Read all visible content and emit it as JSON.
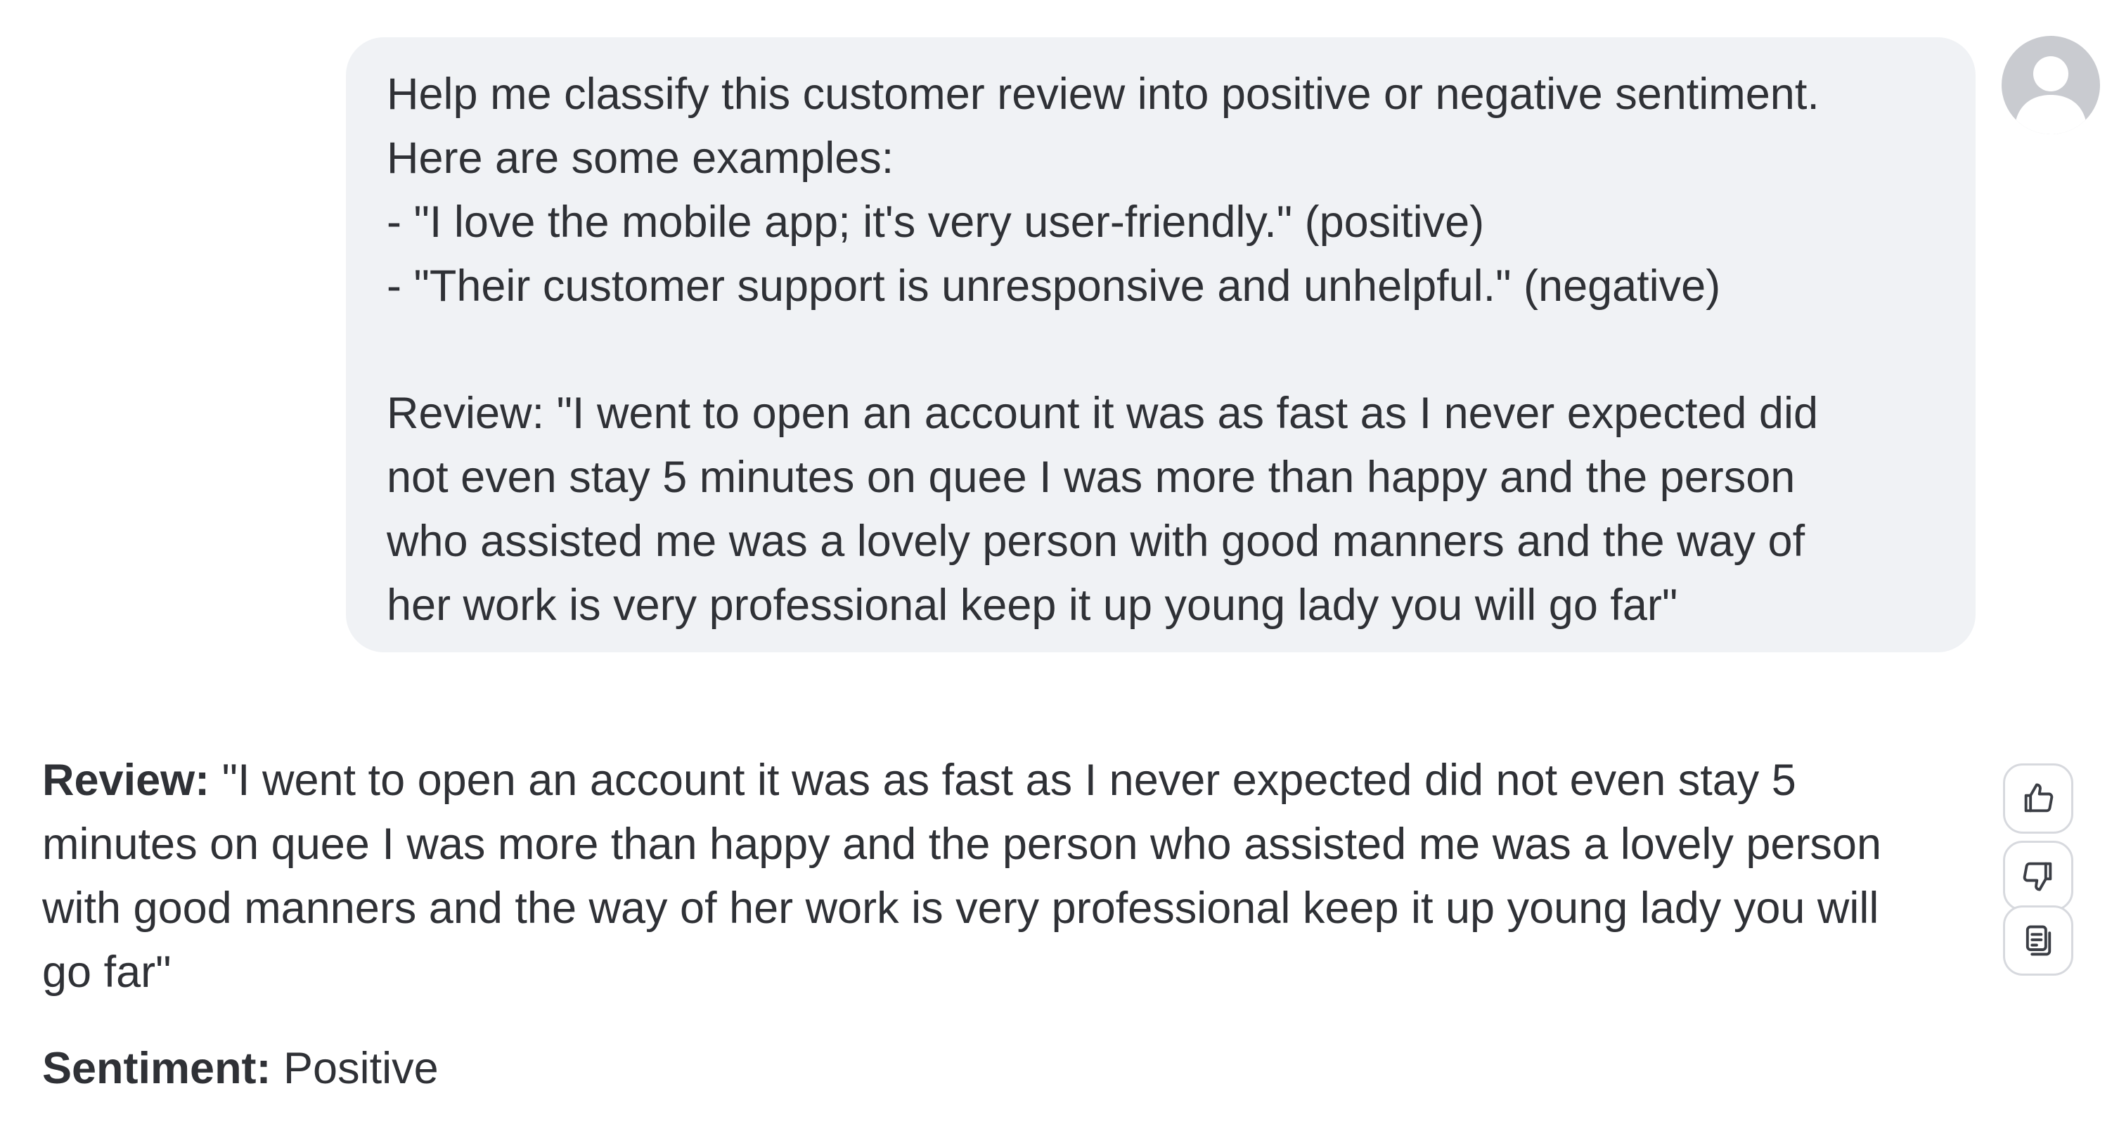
{
  "user_message": {
    "lines": [
      "Help me classify this customer review into positive or negative sentiment.",
      "Here are some examples:",
      "- \"I love the mobile app; it's very user-friendly.\" (positive)",
      "- \"Their customer support is unresponsive and unhelpful.\" (negative)",
      "Review: \"I went to open an account it was as fast as I never expected did",
      "not even stay 5 minutes on quee I was more than happy and the person",
      "who assisted me was a lovely person with good manners and the way of",
      "her work is very professional keep it up young lady you will go far\""
    ]
  },
  "avatar": {
    "icon": "user-avatar-icon"
  },
  "response": {
    "review_label": "Review:",
    "review_lines": [
      " \"I went to open an account it was as fast as I never expected did not even stay 5",
      "minutes on quee I was more than happy and the person who assisted me was a lovely person",
      "with good manners and the way of her work is very professional keep it up young lady you will",
      "go far\""
    ],
    "sentiment_label": "Sentiment:",
    "sentiment_value": " Positive"
  },
  "actions": {
    "icons": [
      "thumbs-up-icon",
      "thumbs-down-icon",
      "copy-icon"
    ]
  },
  "colors": {
    "text": "#2f3136",
    "bubble_bg": "#f0f2f5",
    "avatar_bg": "#c9cbd0",
    "button_border": "#d7d9de",
    "icon_stroke": "#3b3e45"
  }
}
